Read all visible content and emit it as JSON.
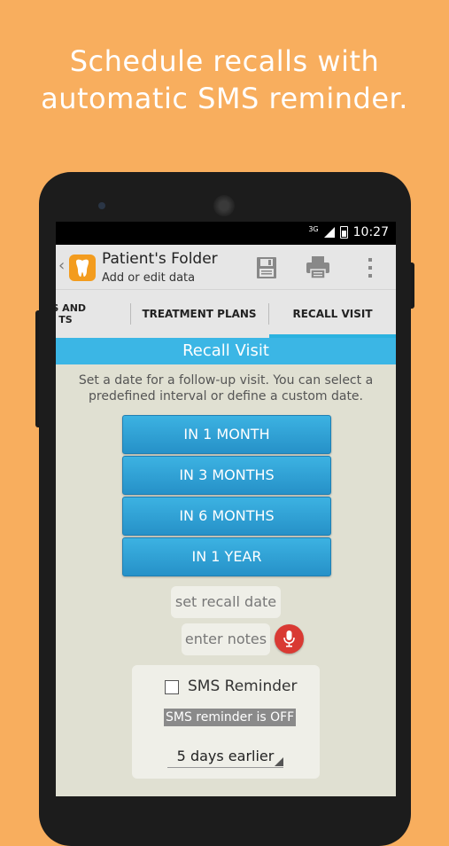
{
  "headline": {
    "line1": "Schedule recalls with",
    "line2": "automatic SMS reminder."
  },
  "status_bar": {
    "network": "3G",
    "time": "10:27"
  },
  "action_bar": {
    "title": "Patient's Folder",
    "subtitle": "Add or edit data"
  },
  "tabs": [
    {
      "label_line1": "SS AND",
      "label_line2": "TS"
    },
    {
      "label": "TREATMENT PLANS"
    },
    {
      "label": "RECALL VISIT",
      "active": true
    }
  ],
  "recall": {
    "section_title": "Recall Visit",
    "description_line1": "Set a date for a follow-up visit. You can select a",
    "description_line2": "predefined interval or define a custom date.",
    "intervals": [
      "IN 1 MONTH",
      "IN 3 MONTHS",
      "IN 6 MONTHS",
      "IN 1 YEAR"
    ],
    "date_placeholder": "set recall date",
    "notes_placeholder": "enter notes"
  },
  "sms": {
    "checkbox_label": "SMS Reminder",
    "checked": false,
    "status": "SMS reminder is OFF",
    "lead_time": "5 days earlier"
  },
  "colors": {
    "background": "#F8AE5E",
    "accent": "#3BB6E5",
    "button": "#2BA3D8",
    "mic": "#D93A33",
    "app_icon": "#F39C1E"
  }
}
